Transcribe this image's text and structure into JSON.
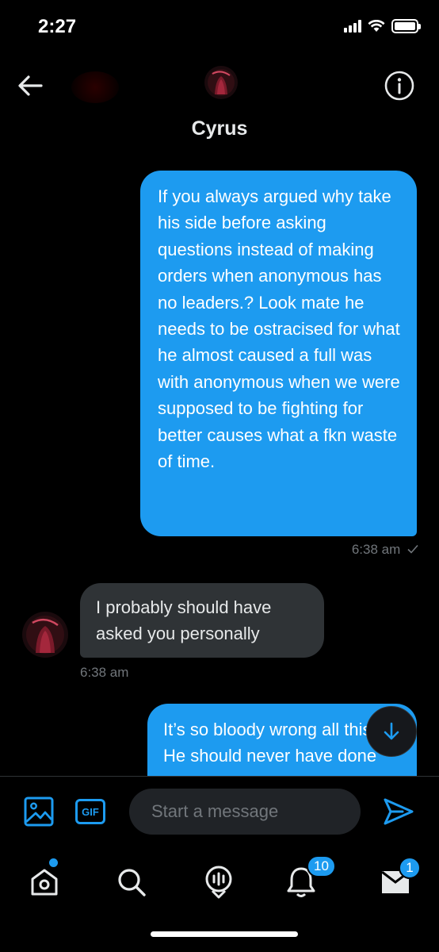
{
  "status_bar": {
    "time": "2:27"
  },
  "header": {
    "contact_name": "Cyrus",
    "icons": {
      "back": "back-arrow-icon",
      "info": "info-icon"
    }
  },
  "messages": [
    {
      "direction": "sent",
      "text": "If you always argued why take his side before asking questions instead of making orders when anonymous has no leaders.? Look mate he needs to be ostracised for what he almost caused a full was with anonymous when we were supposed to be fighting for better causes what a fkn waste of time.",
      "time": "6:38 am"
    },
    {
      "direction": "received",
      "text": "I probably should have asked you personally",
      "time": "6:38 am"
    },
    {
      "direction": "sent",
      "text": "It’s so bloody wrong all this. He should never have done what he did"
    }
  ],
  "composer": {
    "placeholder": "Start a message",
    "gif_label": "GIF"
  },
  "bottom_nav": {
    "items": [
      "home",
      "search",
      "spaces",
      "notifications",
      "messages"
    ],
    "notifications_badge": "10",
    "messages_badge": "1"
  },
  "colors": {
    "accent": "#1d9bf0",
    "background": "#000000",
    "received_bubble": "#2f3336",
    "muted_text": "#71767b"
  }
}
